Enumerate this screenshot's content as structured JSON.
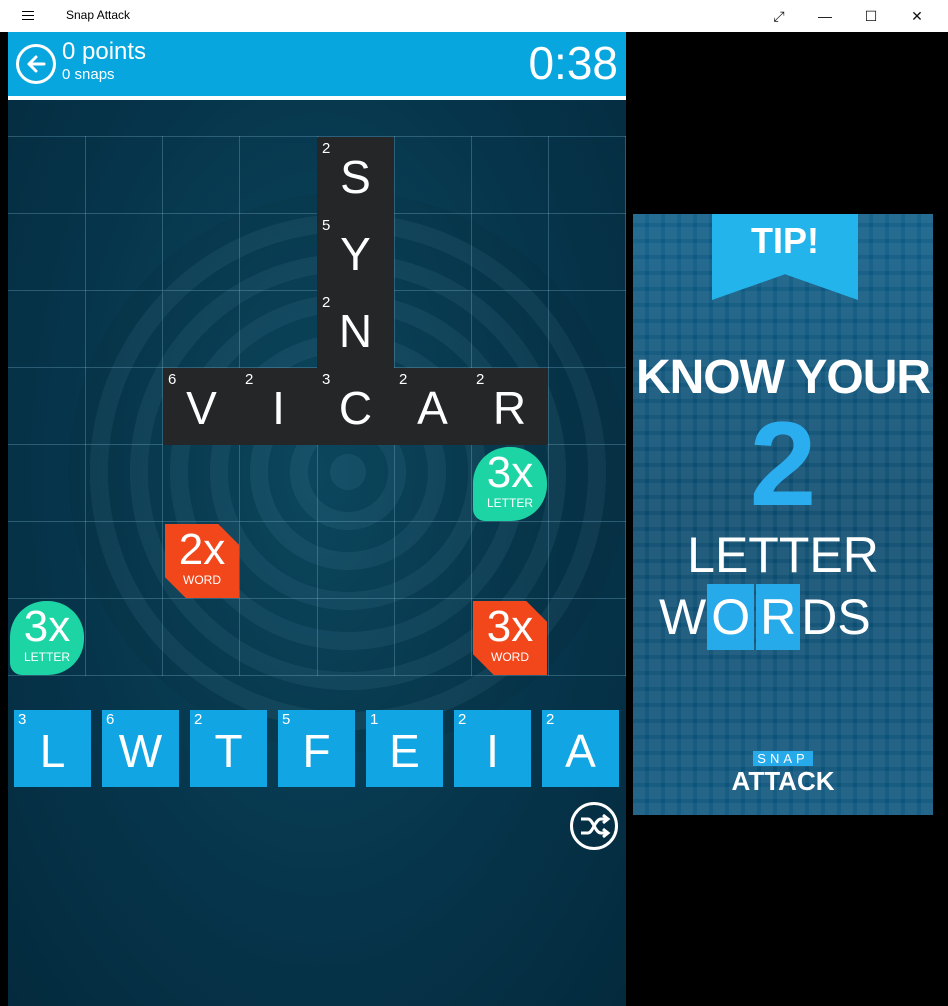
{
  "window": {
    "title": "Snap Attack"
  },
  "header": {
    "points": "0 points",
    "snaps": "0 snaps",
    "timer": "0:38"
  },
  "board": {
    "tiles": [
      {
        "letter": "S",
        "value": "2"
      },
      {
        "letter": "Y",
        "value": "5"
      },
      {
        "letter": "N",
        "value": "2"
      },
      {
        "letter": "V",
        "value": "6"
      },
      {
        "letter": "I",
        "value": "2"
      },
      {
        "letter": "C",
        "value": "3"
      },
      {
        "letter": "A",
        "value": "2"
      },
      {
        "letter": "R",
        "value": "2"
      }
    ],
    "bonuses": [
      {
        "multiplier": "3x",
        "type": "LETTER"
      },
      {
        "multiplier": "2x",
        "type": "WORD"
      },
      {
        "multiplier": "3x",
        "type": "LETTER"
      },
      {
        "multiplier": "3x",
        "type": "WORD"
      }
    ]
  },
  "rack": [
    {
      "letter": "L",
      "value": "3"
    },
    {
      "letter": "W",
      "value": "6"
    },
    {
      "letter": "T",
      "value": "2"
    },
    {
      "letter": "F",
      "value": "5"
    },
    {
      "letter": "E",
      "value": "1"
    },
    {
      "letter": "I",
      "value": "2"
    },
    {
      "letter": "A",
      "value": "2"
    }
  ],
  "ad": {
    "ribbon": "TIP!",
    "line1": "KNOW YOUR",
    "number": "2",
    "line3": "LETTER",
    "word_parts": [
      "W",
      "O",
      "R",
      "DS"
    ],
    "brand_top": "SNAP",
    "brand_bottom": "ATTACK"
  },
  "colors": {
    "header_blue": "#08a6df",
    "rack_blue": "#11a6e3",
    "bonus_green": "#1dd5a4",
    "bonus_red": "#f2461b",
    "tile_dark": "#242627"
  },
  "icons": [
    "menu-icon",
    "back-arrow-icon",
    "shuffle-icon",
    "restore-icon",
    "minimize-icon",
    "maximize-icon",
    "close-icon"
  ]
}
